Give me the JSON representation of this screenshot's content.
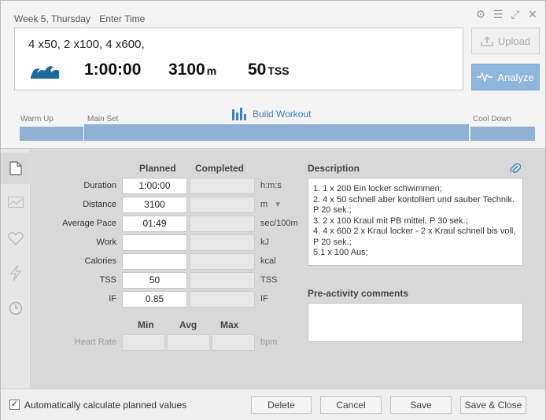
{
  "header": {
    "week_day": "Week 5, Thursday",
    "enter_time": "Enter Time"
  },
  "workout": {
    "title": "4 x50, 2 x100, 4 x600,",
    "duration": "1:00:00",
    "distance_value": "3100",
    "distance_unit": "m",
    "tss_value": "50",
    "tss_unit": "TSS"
  },
  "buttons": {
    "upload": "Upload",
    "analyze": "Analyze"
  },
  "phases": {
    "warm_up": "Warm Up",
    "main_set": "Main Set",
    "cool_down": "Cool Down",
    "build_workout": "Build Workout"
  },
  "metrics_table": {
    "col_planned": "Planned",
    "col_completed": "Completed",
    "rows": [
      {
        "label": "Duration",
        "planned": "1:00:00",
        "completed": "",
        "unit": "h:m:s"
      },
      {
        "label": "Distance",
        "planned": "3100",
        "completed": "",
        "unit": "m"
      },
      {
        "label": "Average Pace",
        "planned": "01:49",
        "completed": "",
        "unit": "sec/100m"
      },
      {
        "label": "Work",
        "planned": "",
        "completed": "",
        "unit": "kJ"
      },
      {
        "label": "Calories",
        "planned": "",
        "completed": "",
        "unit": "kcal"
      },
      {
        "label": "TSS",
        "planned": "50",
        "completed": "",
        "unit": "TSS"
      },
      {
        "label": "IF",
        "planned": "0.85",
        "completed": "",
        "unit": "IF"
      }
    ],
    "hr": {
      "col_min": "Min",
      "col_avg": "Avg",
      "col_max": "Max",
      "label": "Heart Rate",
      "unit": "bpm"
    }
  },
  "description": {
    "heading": "Description",
    "lines": [
      "1. 1 x 200 Ein locker schwimmen;",
      "2. 4 x 50 schnell aber kontolliert und sauber Technik. P 20 sek.;",
      "3. 2 x 100 Kraul mit PB mittel, P 30 sek.;",
      "4. 4 x 600 2 x Kraul locker - 2 x Kraul schnell bis voll, P 20 sek.;",
      "5.1 x 100 Aus;"
    ]
  },
  "pre_activity": {
    "heading": "Pre-activity comments",
    "value": ""
  },
  "footer": {
    "auto_calc_label": "Automatically calculate planned values",
    "auto_calc_checked": true,
    "delete": "Delete",
    "cancel": "Cancel",
    "save": "Save",
    "save_close": "Save & Close"
  },
  "colors": {
    "accent": "#3a7fc1",
    "analyze_bg": "#8fb6dc",
    "swim_icon": "#1e6a9c"
  },
  "icons": [
    "gear-icon",
    "menu-icon",
    "expand-icon",
    "close-icon",
    "swim-icon",
    "upload-icon",
    "pulse-icon",
    "bar-chart-icon",
    "document-icon",
    "graph-icon",
    "heart-icon",
    "lightning-icon",
    "clock-icon",
    "paperclip-icon",
    "checkbox-icon"
  ]
}
